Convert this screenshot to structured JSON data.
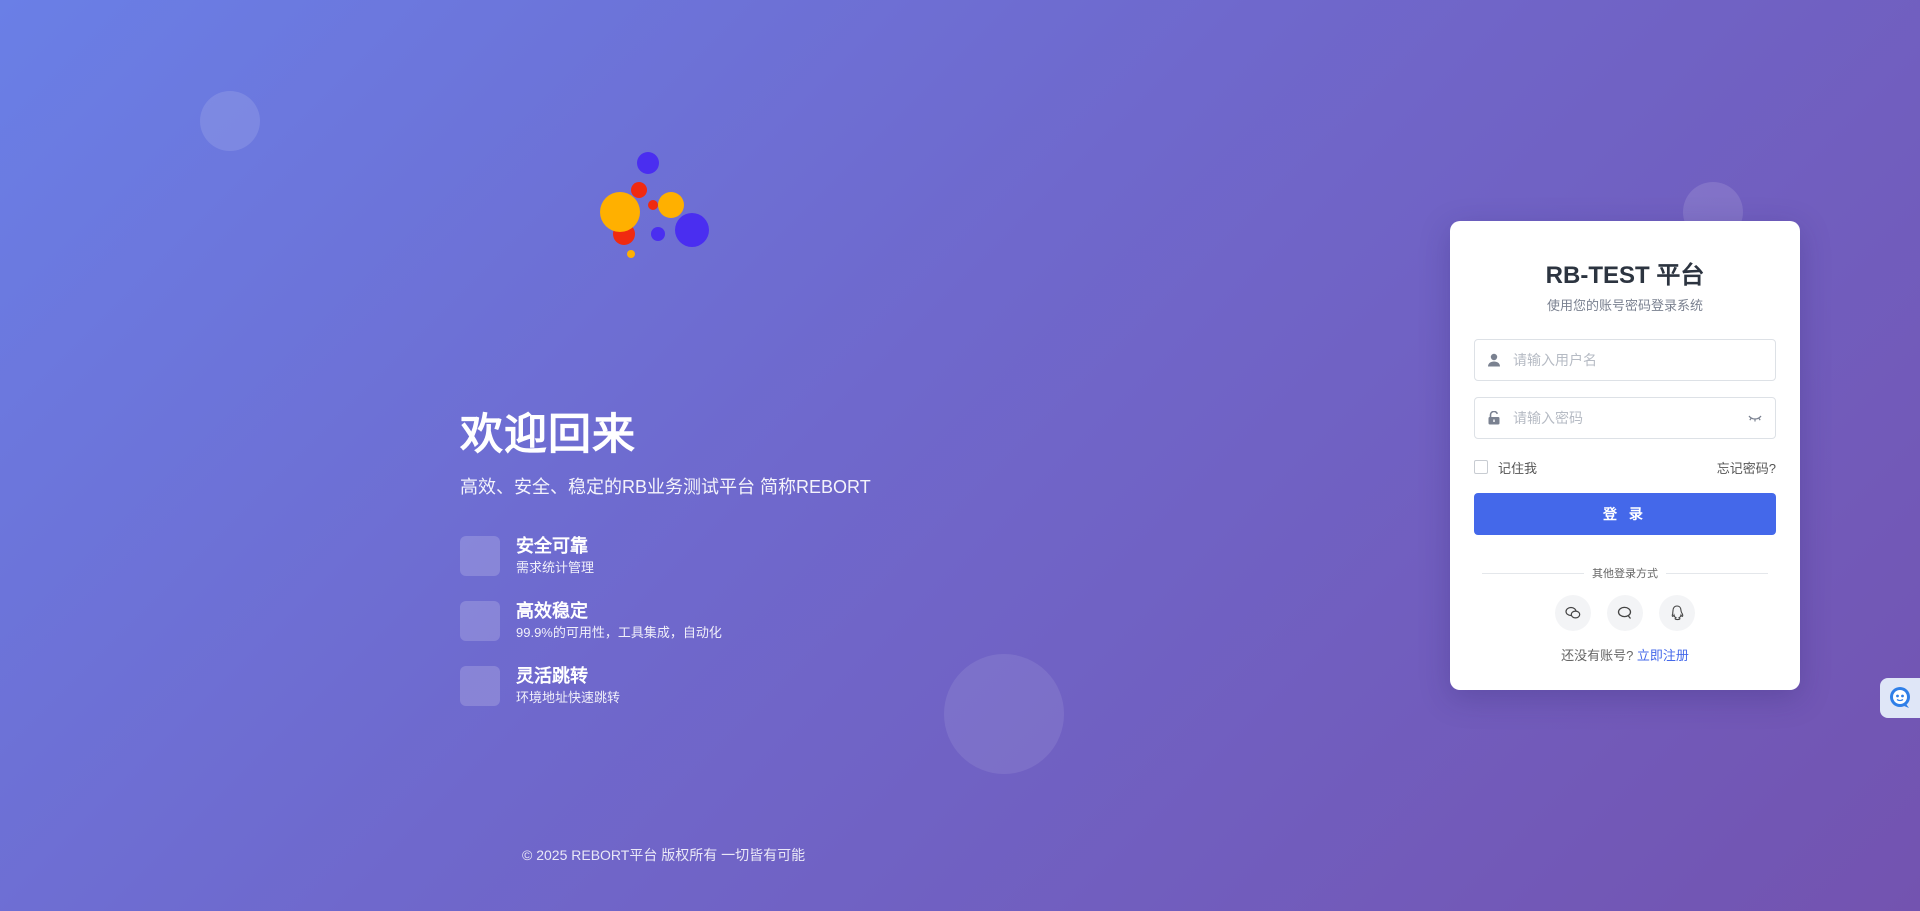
{
  "brand": {
    "logo_icon": "colorful-dots-logo"
  },
  "hero": {
    "title": "欢迎回来",
    "subtitle": "高效、安全、稳定的RB业务测试平台 简称REBORT",
    "features": [
      {
        "title": "安全可靠",
        "desc": "需求统计管理"
      },
      {
        "title": "高效稳定",
        "desc": "99.9%的可用性，工具集成，自动化"
      },
      {
        "title": "灵活跳转",
        "desc": "环境地址快速跳转"
      }
    ]
  },
  "footer": {
    "copyright": "© 2025 REBORT平台 版权所有 一切皆有可能"
  },
  "login": {
    "title": "RB-TEST 平台",
    "subtitle": "使用您的账号密码登录系统",
    "username_placeholder": "请输入用户名",
    "password_placeholder": "请输入密码",
    "remember_label": "记住我",
    "forgot_label": "忘记密码?",
    "submit_label": "登 录",
    "other_methods_label": "其他登录方式",
    "social_icons": [
      "wechat-icon",
      "message-icon",
      "qq-icon"
    ],
    "register_prompt": "还没有账号?",
    "register_link": "立即注册"
  },
  "colors": {
    "primary": "#4468ea",
    "bg_start": "#6a7fe6",
    "bg_end": "#7353b0"
  }
}
